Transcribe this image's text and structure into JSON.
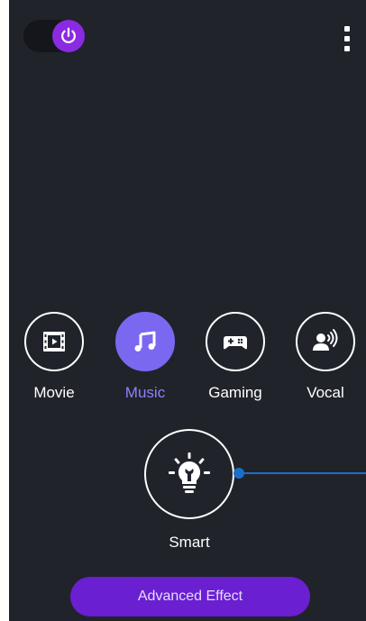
{
  "top_bar": {
    "power_icon": "power-icon",
    "menu_icon": "overflow-menu-icon"
  },
  "modes": [
    {
      "label": "Movie",
      "icon": "film-icon",
      "active": false
    },
    {
      "label": "Music",
      "icon": "music-note-icon",
      "active": true
    },
    {
      "label": "Gaming",
      "icon": "gamepad-icon",
      "active": false
    },
    {
      "label": "Vocal",
      "icon": "speaker-voice-icon",
      "active": false
    }
  ],
  "smart": {
    "label": "Smart",
    "icon": "lightbulb-wrench-icon"
  },
  "advanced_button": {
    "label": "Advanced Effect"
  },
  "colors": {
    "background": "#20232a",
    "accent_purple": "#8a2be2",
    "active_mode": "#7b68f0",
    "active_label": "#8b82ff",
    "slider": "#1b6fc7",
    "button": "#6a1fd1"
  }
}
